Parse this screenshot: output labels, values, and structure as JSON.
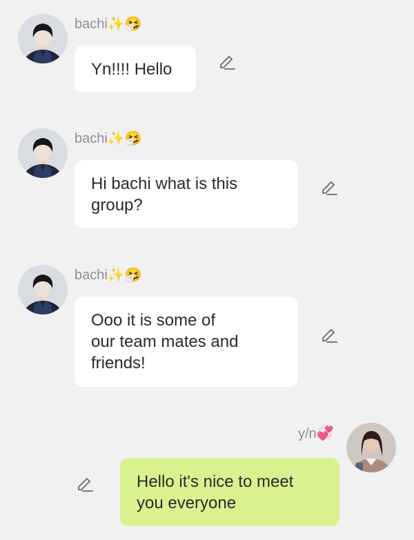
{
  "colors": {
    "background": "#f1f1f1",
    "bubble_incoming": "#ffffff",
    "bubble_outgoing": "#d9f28f",
    "sender_name": "#8f8f8f",
    "text": "#2a2a2a",
    "icon": "#777777"
  },
  "messages": [
    {
      "sender": "bachi",
      "sender_emoji": "✨🤧",
      "text": "Yn!!!! Hello",
      "avatar_icon": "dark-haired-avatar",
      "edit_icon": "pencil-icon"
    },
    {
      "sender": "bachi",
      "sender_emoji": "✨🤧",
      "text": "Hi bachi what is this\ngroup?",
      "avatar_icon": "dark-haired-avatar",
      "edit_icon": "pencil-icon"
    },
    {
      "sender": "bachi",
      "sender_emoji": "✨🤧",
      "text": "Ooo it is some of\nour team mates and\nfriends!",
      "avatar_icon": "dark-haired-avatar",
      "edit_icon": "pencil-icon"
    },
    {
      "sender": "y/n",
      "sender_emoji": "💞",
      "text": "Hello it's nice to meet\nyou everyone",
      "avatar_icon": "girl-avatar",
      "edit_icon": "pencil-icon"
    }
  ]
}
